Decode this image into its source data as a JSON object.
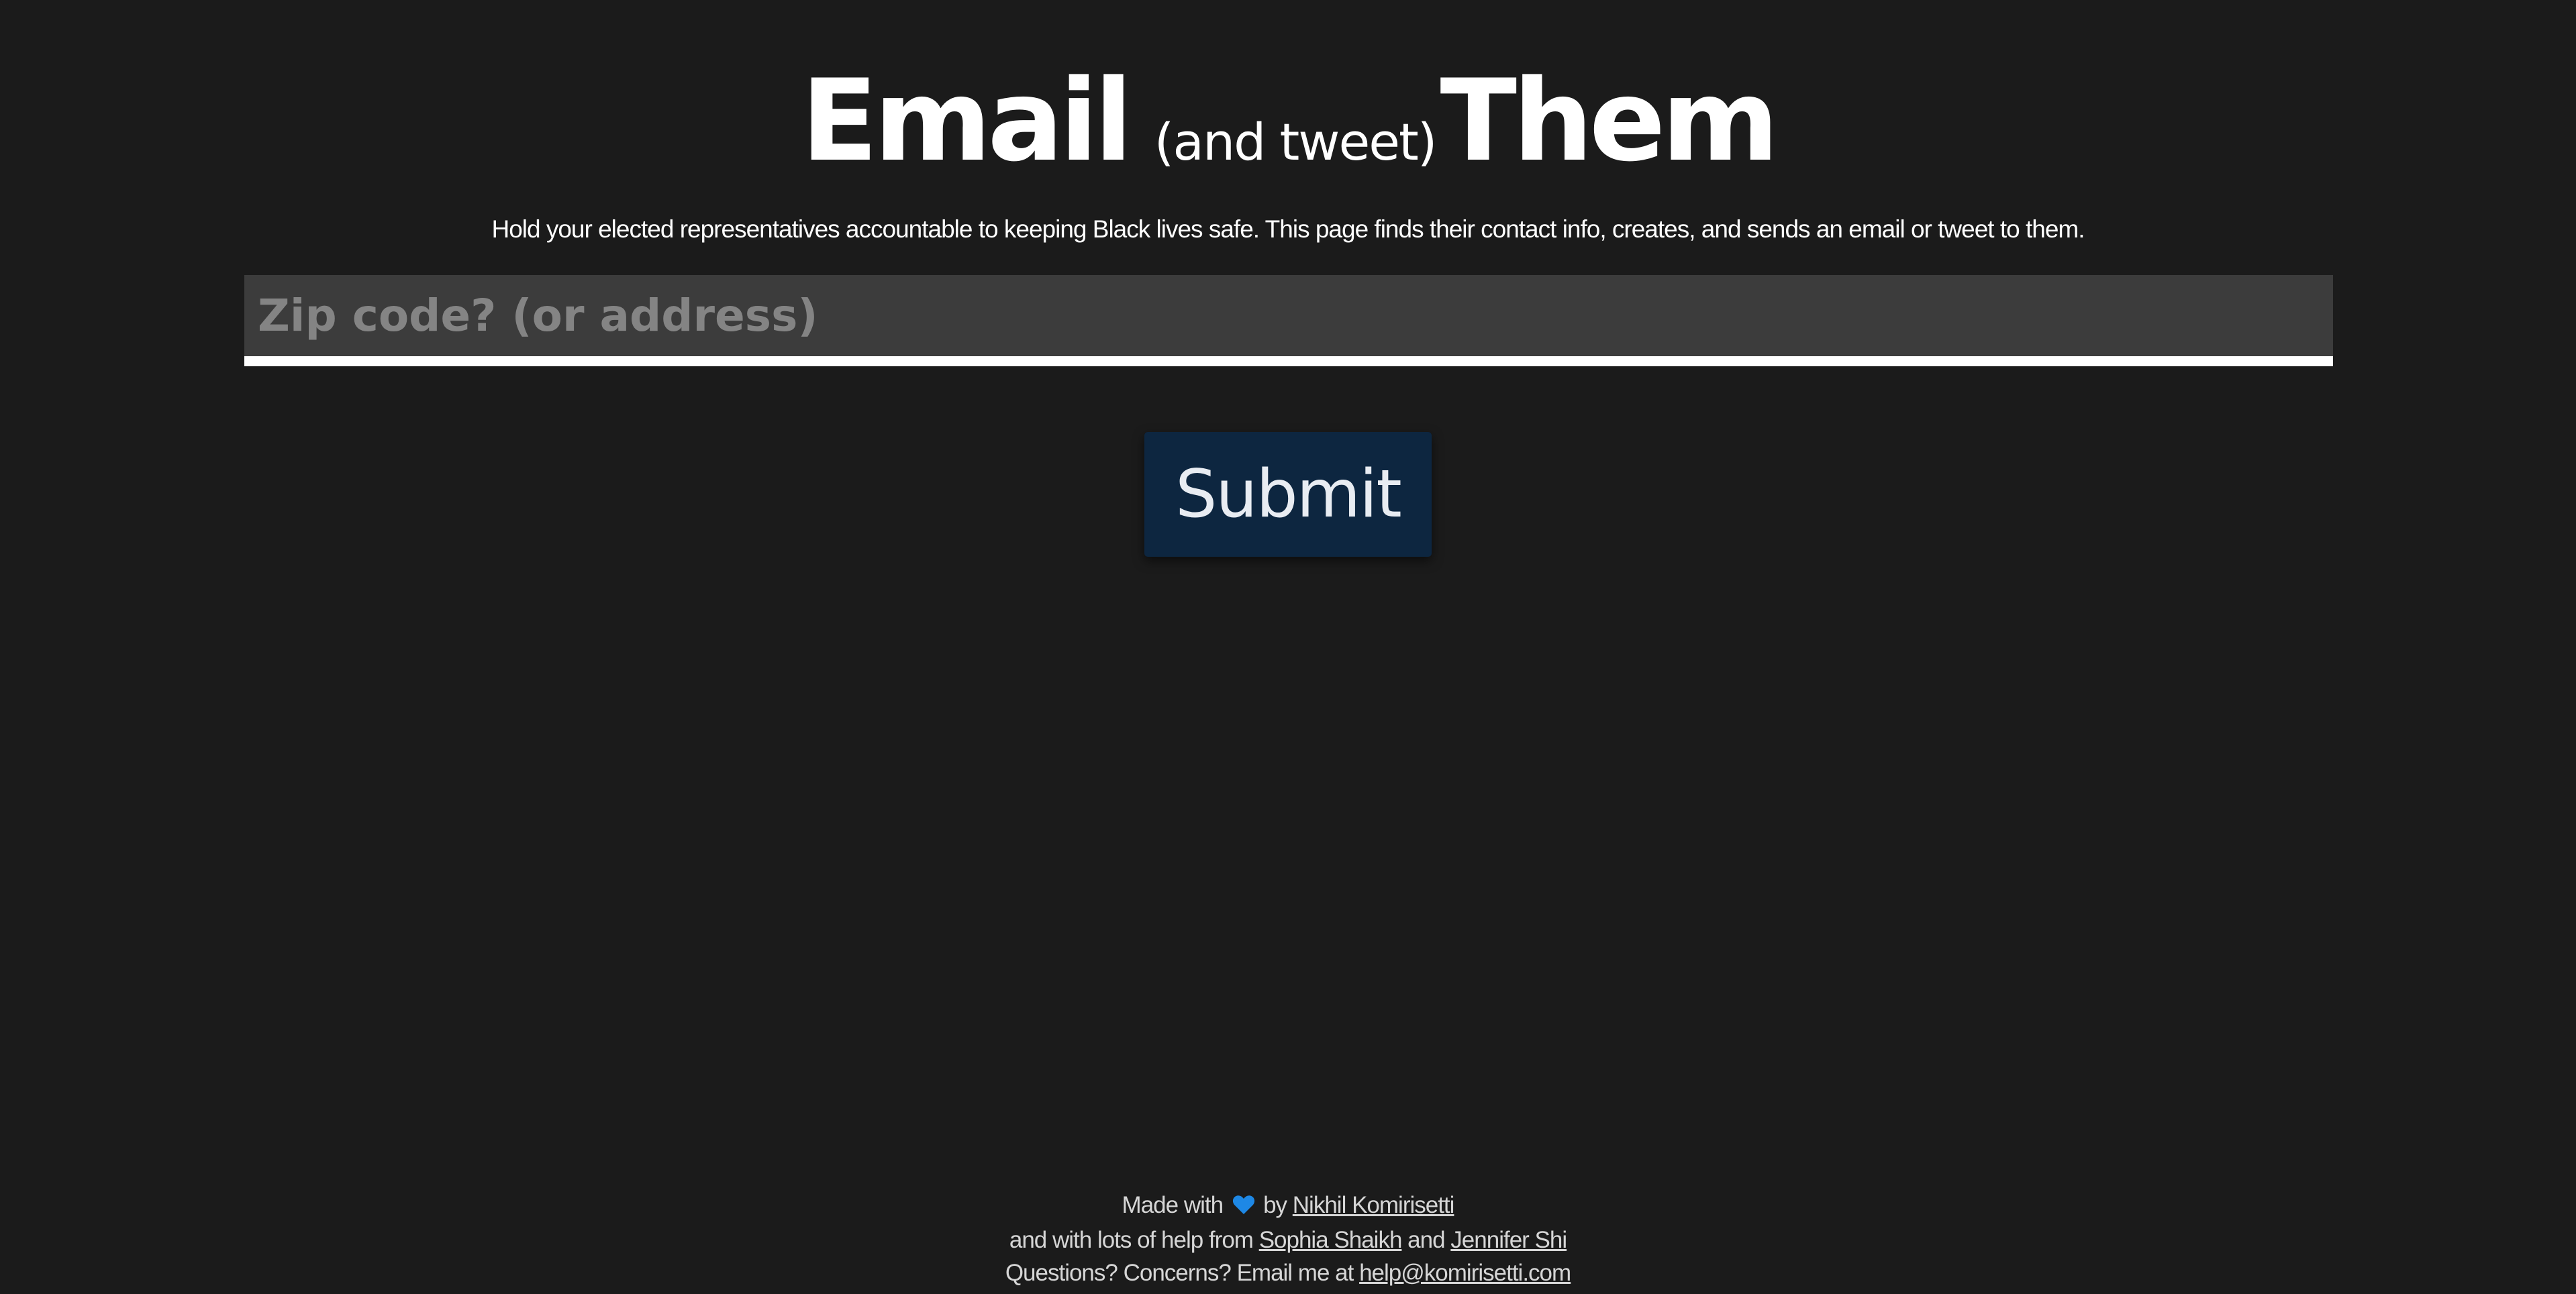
{
  "header": {
    "title_main": "Email",
    "title_aside": "(and tweet)",
    "title_end": "Them",
    "subtitle": "Hold your elected representatives accountable to keeping Black lives safe. This page finds their contact info, creates, and sends an email or tweet to them."
  },
  "form": {
    "zip_placeholder": "Zip code? (or address)",
    "zip_value": "",
    "submit_label": "Submit"
  },
  "footer": {
    "line1_prefix": "Made with",
    "heart_icon": "heart-icon",
    "heart_color": "#1e88e5",
    "line1_by": "by",
    "author": "Nikhil Komirisetti",
    "line2_prefix": "and with lots of help from",
    "helper1": "Sophia Shaikh",
    "line2_and": "and",
    "helper2": "Jennifer Shi",
    "line3_prefix": "Questions? Concerns? Email me at",
    "email": "help@komirisetti.com"
  },
  "colors": {
    "background": "#1b1b1b",
    "input_background": "#3c3c3c",
    "button_background": "#0d2640",
    "text": "#ffffff"
  }
}
